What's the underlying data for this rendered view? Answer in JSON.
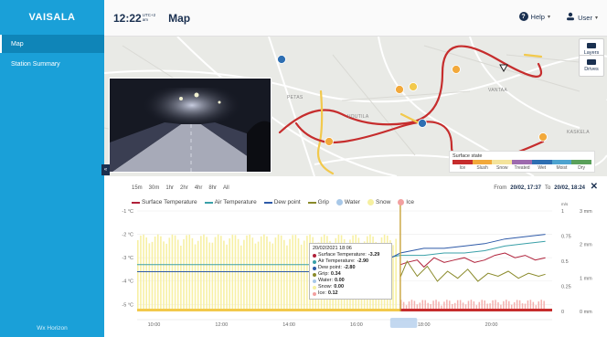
{
  "sidebar": {
    "logo": "VAISALA",
    "items": [
      {
        "label": "Map",
        "active": true
      },
      {
        "label": "Station Summary",
        "active": false
      }
    ],
    "brand": "Wx Horizon"
  },
  "header": {
    "time": "12:22",
    "tz_top": "UTC+2",
    "tz_bottom": "am",
    "title": "Map",
    "help_label": "Help",
    "user_label": "User"
  },
  "map": {
    "buttons": {
      "layers": "Layers",
      "drives": "Drives"
    },
    "place_labels": [
      "PETAS",
      "VOUTILA",
      "VANTAA",
      "KASKELA"
    ],
    "legend": {
      "title": "Surface state",
      "states": [
        {
          "label": "Ice",
          "color": "#c62d2d"
        },
        {
          "label": "Slush",
          "color": "#f2a93b"
        },
        {
          "label": "Snow",
          "color": "#f4e39b"
        },
        {
          "label": "Treated",
          "color": "#9d6aae"
        },
        {
          "label": "Wet",
          "color": "#2e6fb2"
        },
        {
          "label": "Moist",
          "color": "#4ea3cf"
        },
        {
          "label": "Dry",
          "color": "#5aa05a"
        }
      ]
    }
  },
  "chart": {
    "ranges": [
      "15m",
      "30m",
      "1hr",
      "2hr",
      "4hr",
      "8hr",
      "All"
    ],
    "from_label": "From",
    "from_value": "20/02, 17:37",
    "to_label": "To",
    "to_value": "20/02, 18:24",
    "close": "✕",
    "legend": [
      {
        "label": "Surface Temperature",
        "color": "#b0213a",
        "kind": "line"
      },
      {
        "label": "Air Temperature",
        "color": "#3aa0a8",
        "kind": "line"
      },
      {
        "label": "Dew point",
        "color": "#2e5aa8",
        "kind": "line"
      },
      {
        "label": "Grip",
        "color": "#8a8a2a",
        "kind": "line"
      },
      {
        "label": "Water",
        "color": "#a8c8e8",
        "kind": "dot"
      },
      {
        "label": "Snow",
        "color": "#f6f0a0",
        "kind": "dot"
      },
      {
        "label": "Ice",
        "color": "#f2a0a0",
        "kind": "dot"
      }
    ],
    "tooltip": {
      "time": "20/02/2021 18:06",
      "rows": [
        {
          "label": "Surface Temperature:",
          "value": "-3.29",
          "color": "#b0213a"
        },
        {
          "label": "Air Temperature:",
          "value": "-2.90",
          "color": "#3aa0a8"
        },
        {
          "label": "Dew point:",
          "value": "-2.80",
          "color": "#2e5aa8"
        },
        {
          "label": "Grip:",
          "value": "0.34",
          "color": "#8a8a2a"
        },
        {
          "label": "Water:",
          "value": "0.00",
          "color": "#a8c8e8"
        },
        {
          "label": "Snow:",
          "value": "0.00",
          "color": "#f6f0a0"
        },
        {
          "label": "Ice:",
          "value": "0.12",
          "color": "#f2a0a0"
        }
      ]
    }
  },
  "chart_data": {
    "type": "line",
    "x_ticks": [
      "10:00",
      "12:00",
      "14:00",
      "16:00",
      "18:00",
      "20:00"
    ],
    "y_left_ticks": [
      "-1 °C",
      "-2 °C",
      "-3 °C",
      "-4 °C",
      "-5 °C"
    ],
    "y_left_range": [
      -5.3,
      -1
    ],
    "y_right_grip_unit": "m/s",
    "y_right_grip_ticks": [
      "1",
      "0.75",
      "0.5",
      "0.25",
      "0"
    ],
    "y_right_grip_range": [
      0,
      1
    ],
    "y_right_mm_ticks": [
      "3 mm",
      "2 mm",
      "1 mm",
      "0 mm"
    ],
    "y_right_mm_range": [
      0,
      3
    ],
    "x_range": [
      9.5,
      21.8
    ],
    "cursor_x": 17.3,
    "series": [
      {
        "name": "Surface Temperature",
        "color": "#b0213a",
        "x": [
          17.3,
          17.5,
          17.8,
          18.0,
          18.3,
          18.6,
          18.9,
          19.2,
          19.5,
          19.8,
          20.1,
          20.4,
          20.7,
          21.0,
          21.3,
          21.6
        ],
        "y": [
          -3.3,
          -3.2,
          -3.1,
          -3.4,
          -3.0,
          -3.2,
          -3.1,
          -3.0,
          -3.2,
          -3.1,
          -2.9,
          -2.8,
          -3.0,
          -2.9,
          -3.1,
          -3.0
        ]
      },
      {
        "name": "Air Temperature",
        "color": "#3aa0a8",
        "x": [
          9.5,
          11.0,
          12.5,
          14.0,
          15.5,
          16.5,
          17.3,
          18.0,
          18.6,
          19.2,
          19.8,
          20.4,
          21.0,
          21.6
        ],
        "y": [
          -3.3,
          -3.3,
          -3.3,
          -3.3,
          -3.3,
          -3.1,
          -2.9,
          -2.9,
          -2.8,
          -2.8,
          -2.7,
          -2.5,
          -2.4,
          -2.3
        ]
      },
      {
        "name": "Dew point",
        "color": "#2e5aa8",
        "x": [
          9.5,
          11.0,
          12.5,
          14.0,
          15.5,
          16.5,
          17.3,
          18.0,
          18.6,
          19.2,
          19.8,
          20.4,
          21.0,
          21.6
        ],
        "y": [
          -3.6,
          -3.6,
          -3.6,
          -3.6,
          -3.6,
          -3.4,
          -2.8,
          -2.6,
          -2.6,
          -2.5,
          -2.4,
          -2.2,
          -2.1,
          -2.0
        ]
      },
      {
        "name": "Grip",
        "color": "#8a8a2a",
        "x": [
          17.3,
          17.5,
          17.8,
          18.1,
          18.4,
          18.7,
          19.0,
          19.3,
          19.6,
          19.9,
          20.2,
          20.5,
          20.8,
          21.1,
          21.4,
          21.6
        ],
        "y": [
          0.34,
          0.5,
          0.35,
          0.45,
          0.3,
          0.4,
          0.33,
          0.42,
          0.3,
          0.38,
          0.35,
          0.4,
          0.33,
          0.38,
          0.35,
          0.37
        ]
      }
    ],
    "snow_bars": {
      "x_start": 9.5,
      "x_end": 17.2,
      "mm": 2.3
    },
    "ice_bars": {
      "x_start": 17.3,
      "x_end": 21.6,
      "mm": 0.35
    }
  }
}
